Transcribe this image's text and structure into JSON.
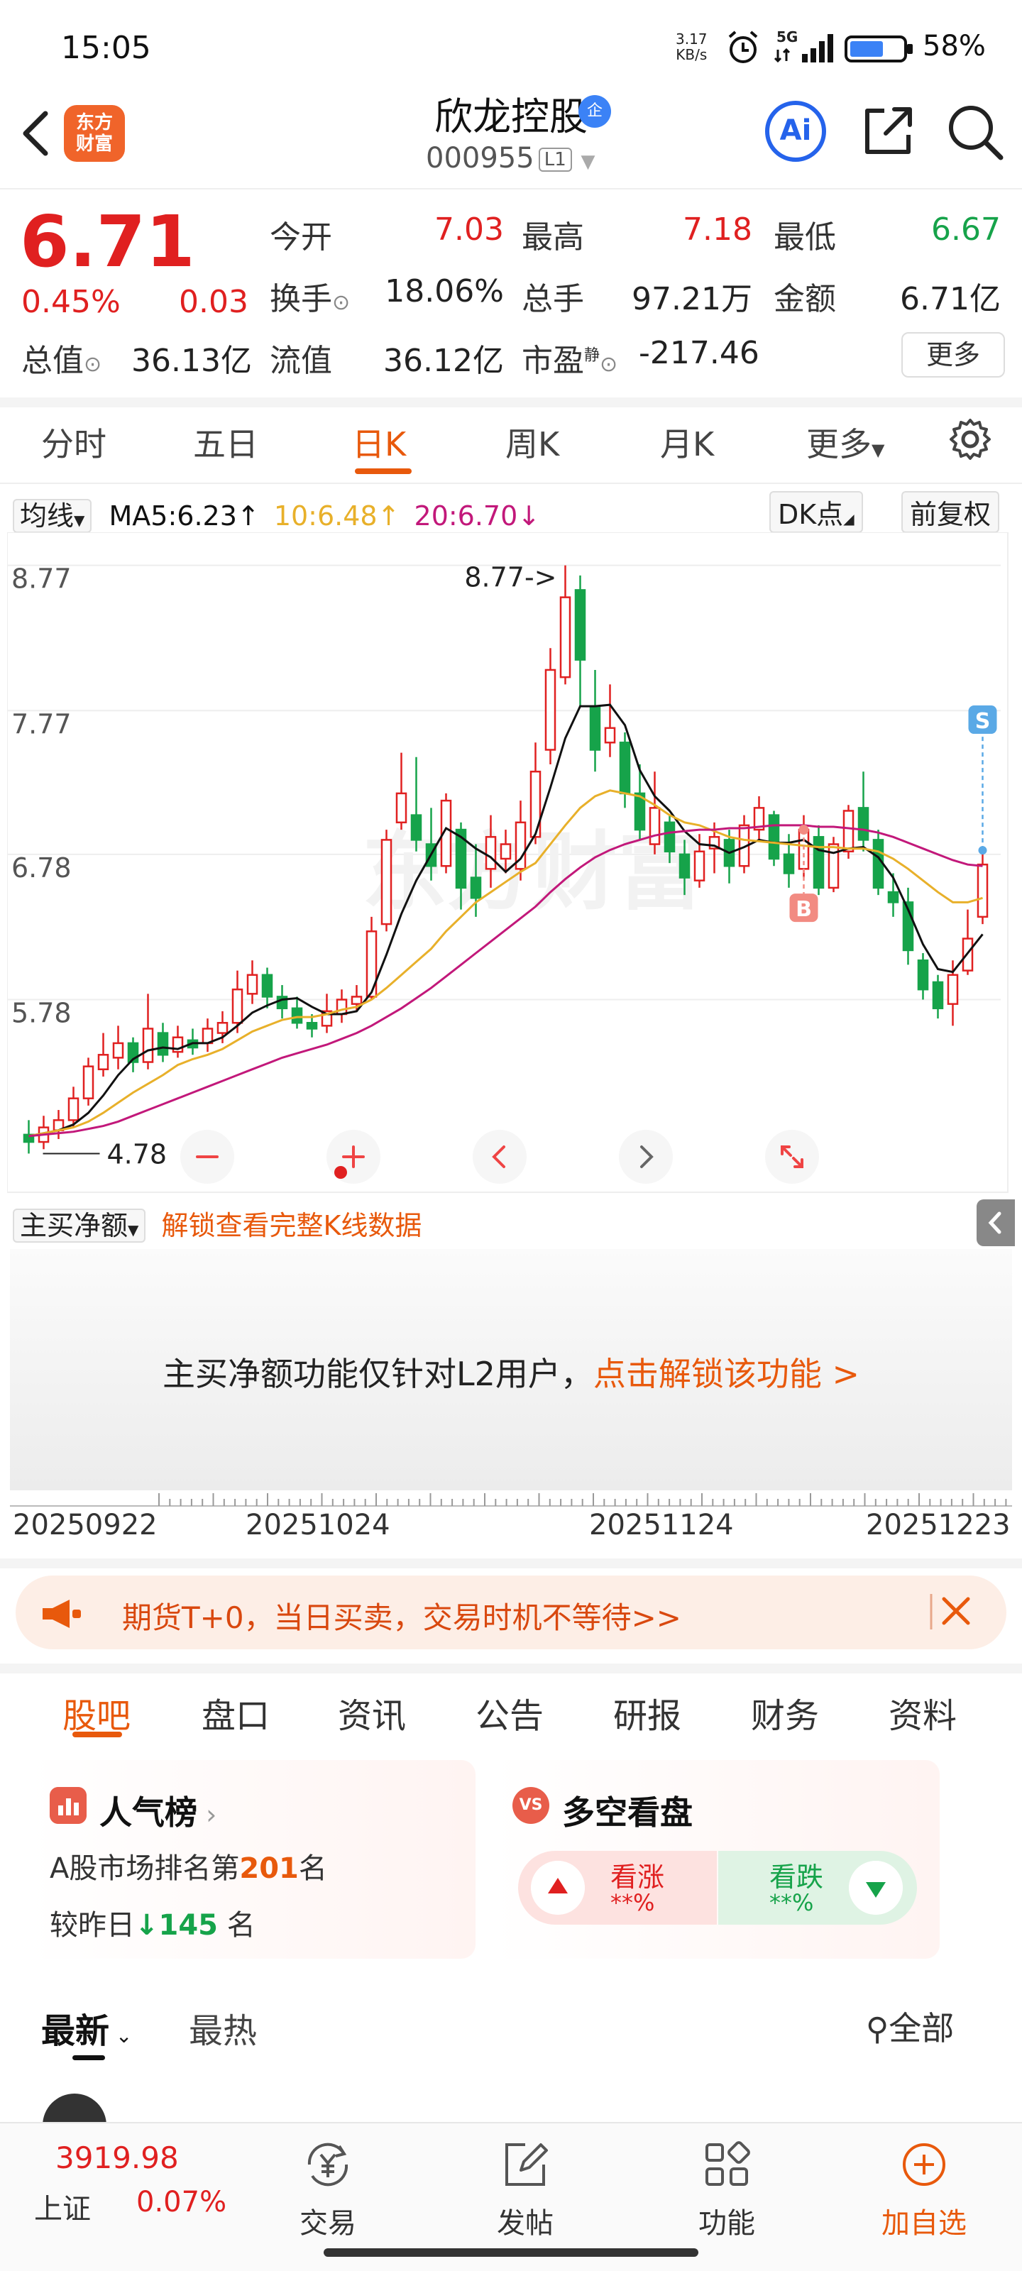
{
  "status_bar": {
    "time": "15:05",
    "net_speed_value": "3.17",
    "net_speed_unit": "KB/s",
    "signal_label": "5G",
    "battery_pct": "58%"
  },
  "header": {
    "logo_text": "东方财富",
    "stock_name": "欣龙控股",
    "badge": "企",
    "stock_code": "000955",
    "level": "L1",
    "ai_label": "Ai"
  },
  "quote": {
    "price": "6.71",
    "change_pct": "0.45%",
    "change": "0.03",
    "open_label": "今开",
    "open": "7.03",
    "high_label": "最高",
    "high": "7.18",
    "low_label": "最低",
    "low": "6.67",
    "turnover_label": "换手",
    "turnover": "18.06%",
    "volume_label": "总手",
    "volume": "97.21万",
    "amount_label": "金额",
    "amount": "6.71亿",
    "mktcap_label": "总值",
    "mktcap": "36.13亿",
    "float_label": "流值",
    "float_cap": "36.12亿",
    "pe_label": "市盈",
    "pe_sup": "静",
    "pe": "-217.46",
    "more_label": "更多"
  },
  "chart_tabs": [
    "分时",
    "五日",
    "日K",
    "周K",
    "月K",
    "更多"
  ],
  "ma_row": {
    "selector": "均线",
    "ma5": "MA5:6.23",
    "ma10": "10:6.48",
    "ma20": "20:6.70",
    "dk_label": "DK点",
    "adjust_label": "前复权"
  },
  "colors": {
    "up": "#e02020",
    "down": "#16a34a",
    "accent": "#e8590c",
    "ma5": "#111111",
    "ma10": "#e8b02a",
    "ma20": "#c2187a"
  },
  "chart_data": {
    "type": "candlestick",
    "y_ticks": [
      "8.77",
      "7.77",
      "6.78",
      "5.78"
    ],
    "ylim": [
      4.6,
      8.9
    ],
    "peak_annotation": "8.77->",
    "low_annotation": "4.78",
    "buy_marker": "B",
    "sell_marker": "S",
    "candles": [
      {
        "o": 4.85,
        "c": 4.8,
        "h": 4.95,
        "l": 4.72
      },
      {
        "o": 4.8,
        "c": 4.9,
        "h": 4.98,
        "l": 4.75
      },
      {
        "o": 4.88,
        "c": 4.95,
        "h": 5.02,
        "l": 4.82
      },
      {
        "o": 4.95,
        "c": 5.1,
        "h": 5.18,
        "l": 4.9
      },
      {
        "o": 5.1,
        "c": 5.32,
        "h": 5.38,
        "l": 5.05
      },
      {
        "o": 5.3,
        "c": 5.4,
        "h": 5.55,
        "l": 5.25
      },
      {
        "o": 5.38,
        "c": 5.48,
        "h": 5.6,
        "l": 5.3
      },
      {
        "o": 5.48,
        "c": 5.35,
        "h": 5.52,
        "l": 5.28
      },
      {
        "o": 5.35,
        "c": 5.58,
        "h": 5.82,
        "l": 5.3
      },
      {
        "o": 5.55,
        "c": 5.4,
        "h": 5.62,
        "l": 5.35
      },
      {
        "o": 5.42,
        "c": 5.52,
        "h": 5.6,
        "l": 5.38
      },
      {
        "o": 5.5,
        "c": 5.45,
        "h": 5.58,
        "l": 5.4
      },
      {
        "o": 5.48,
        "c": 5.58,
        "h": 5.65,
        "l": 5.42
      },
      {
        "o": 5.55,
        "c": 5.62,
        "h": 5.7,
        "l": 5.48
      },
      {
        "o": 5.62,
        "c": 5.85,
        "h": 5.98,
        "l": 5.55
      },
      {
        "o": 5.82,
        "c": 5.95,
        "h": 6.05,
        "l": 5.75
      },
      {
        "o": 5.95,
        "c": 5.8,
        "h": 6.0,
        "l": 5.72
      },
      {
        "o": 5.8,
        "c": 5.72,
        "h": 5.88,
        "l": 5.65
      },
      {
        "o": 5.72,
        "c": 5.62,
        "h": 5.8,
        "l": 5.58
      },
      {
        "o": 5.62,
        "c": 5.58,
        "h": 5.68,
        "l": 5.52
      },
      {
        "o": 5.6,
        "c": 5.7,
        "h": 5.82,
        "l": 5.55
      },
      {
        "o": 5.68,
        "c": 5.78,
        "h": 5.85,
        "l": 5.62
      },
      {
        "o": 5.75,
        "c": 5.8,
        "h": 5.88,
        "l": 5.7
      },
      {
        "o": 5.8,
        "c": 6.25,
        "h": 6.35,
        "l": 5.78
      },
      {
        "o": 6.3,
        "c": 6.88,
        "h": 6.95,
        "l": 6.25
      },
      {
        "o": 7.0,
        "c": 7.2,
        "h": 7.48,
        "l": 6.95
      },
      {
        "o": 7.05,
        "c": 6.88,
        "h": 7.45,
        "l": 6.8
      },
      {
        "o": 6.85,
        "c": 6.7,
        "h": 7.1,
        "l": 6.6
      },
      {
        "o": 6.7,
        "c": 7.15,
        "h": 7.2,
        "l": 6.65
      },
      {
        "o": 6.95,
        "c": 6.55,
        "h": 7.0,
        "l": 6.4
      },
      {
        "o": 6.62,
        "c": 6.48,
        "h": 6.85,
        "l": 6.35
      },
      {
        "o": 6.68,
        "c": 6.9,
        "h": 7.05,
        "l": 6.55
      },
      {
        "o": 6.75,
        "c": 6.85,
        "h": 6.95,
        "l": 6.65
      },
      {
        "o": 6.68,
        "c": 7.0,
        "h": 7.15,
        "l": 6.6
      },
      {
        "o": 6.9,
        "c": 7.35,
        "h": 7.55,
        "l": 6.85
      },
      {
        "o": 7.5,
        "c": 8.05,
        "h": 8.2,
        "l": 7.4
      },
      {
        "o": 8.0,
        "c": 8.55,
        "h": 8.77,
        "l": 7.95
      },
      {
        "o": 8.6,
        "c": 8.12,
        "h": 8.7,
        "l": 7.8
      },
      {
        "o": 7.8,
        "c": 7.5,
        "h": 8.05,
        "l": 7.35
      },
      {
        "o": 7.55,
        "c": 7.65,
        "h": 7.95,
        "l": 7.45
      },
      {
        "o": 7.55,
        "c": 7.2,
        "h": 7.62,
        "l": 7.1
      },
      {
        "o": 7.2,
        "c": 6.95,
        "h": 7.4,
        "l": 6.88
      },
      {
        "o": 6.85,
        "c": 7.1,
        "h": 7.35,
        "l": 6.78
      },
      {
        "o": 7.0,
        "c": 6.8,
        "h": 7.05,
        "l": 6.72
      },
      {
        "o": 6.78,
        "c": 6.62,
        "h": 6.88,
        "l": 6.5
      },
      {
        "o": 6.6,
        "c": 6.8,
        "h": 6.92,
        "l": 6.55
      },
      {
        "o": 6.82,
        "c": 6.9,
        "h": 7.0,
        "l": 6.65
      },
      {
        "o": 6.88,
        "c": 6.7,
        "h": 6.95,
        "l": 6.58
      },
      {
        "o": 6.7,
        "c": 6.98,
        "h": 7.05,
        "l": 6.65
      },
      {
        "o": 6.95,
        "c": 7.1,
        "h": 7.18,
        "l": 6.88
      },
      {
        "o": 7.05,
        "c": 6.75,
        "h": 7.08,
        "l": 6.7
      },
      {
        "o": 6.78,
        "c": 6.65,
        "h": 6.92,
        "l": 6.55
      },
      {
        "o": 6.68,
        "c": 6.95,
        "h": 7.05,
        "l": 6.62
      },
      {
        "o": 6.9,
        "c": 6.55,
        "h": 6.98,
        "l": 6.5
      },
      {
        "o": 6.55,
        "c": 6.85,
        "h": 6.9,
        "l": 6.52
      },
      {
        "o": 6.8,
        "c": 7.08,
        "h": 7.12,
        "l": 6.75
      },
      {
        "o": 7.1,
        "c": 6.88,
        "h": 7.35,
        "l": 6.8
      },
      {
        "o": 6.88,
        "c": 6.55,
        "h": 6.95,
        "l": 6.5
      },
      {
        "o": 6.52,
        "c": 6.45,
        "h": 6.65,
        "l": 6.35
      },
      {
        "o": 6.45,
        "c": 6.12,
        "h": 6.55,
        "l": 6.02
      },
      {
        "o": 6.05,
        "c": 5.85,
        "h": 6.1,
        "l": 5.78
      },
      {
        "o": 5.9,
        "c": 5.72,
        "h": 5.95,
        "l": 5.65
      },
      {
        "o": 5.75,
        "c": 5.95,
        "h": 6.05,
        "l": 5.6
      },
      {
        "o": 5.98,
        "c": 6.2,
        "h": 6.4,
        "l": 5.95
      },
      {
        "o": 6.35,
        "c": 6.71,
        "h": 6.82,
        "l": 6.3
      }
    ],
    "ma5": [
      4.84,
      4.86,
      4.88,
      4.92,
      5.0,
      5.12,
      5.26,
      5.37,
      5.43,
      5.45,
      5.44,
      5.48,
      5.48,
      5.52,
      5.6,
      5.69,
      5.74,
      5.78,
      5.79,
      5.73,
      5.68,
      5.68,
      5.7,
      5.83,
      6.09,
      6.37,
      6.6,
      6.78,
      6.96,
      6.9,
      6.82,
      6.76,
      6.66,
      6.75,
      6.92,
      7.24,
      7.58,
      7.8,
      7.8,
      7.81,
      7.67,
      7.36,
      7.18,
      7.08,
      6.94,
      6.85,
      6.84,
      6.79,
      6.83,
      6.88,
      6.86,
      6.86,
      6.88,
      6.81,
      6.79,
      6.82,
      6.83,
      6.76,
      6.62,
      6.4,
      6.16,
      5.99,
      5.97,
      6.1,
      6.23
    ],
    "ma10": [
      4.84,
      4.86,
      4.88,
      4.9,
      4.94,
      5.0,
      5.07,
      5.14,
      5.2,
      5.26,
      5.33,
      5.37,
      5.4,
      5.44,
      5.5,
      5.56,
      5.6,
      5.64,
      5.66,
      5.66,
      5.68,
      5.71,
      5.73,
      5.78,
      5.86,
      5.95,
      6.04,
      6.13,
      6.25,
      6.35,
      6.45,
      6.52,
      6.59,
      6.66,
      6.72,
      6.85,
      6.98,
      7.1,
      7.18,
      7.22,
      7.2,
      7.18,
      7.12,
      7.05,
      7.0,
      6.98,
      6.94,
      6.9,
      6.88,
      6.87,
      6.86,
      6.85,
      6.84,
      6.83,
      6.83,
      6.82,
      6.82,
      6.8,
      6.75,
      6.68,
      6.6,
      6.52,
      6.45,
      6.45,
      6.48
    ],
    "ma20": [
      4.84,
      4.85,
      4.86,
      4.87,
      4.89,
      4.91,
      4.94,
      4.98,
      5.02,
      5.06,
      5.1,
      5.14,
      5.18,
      5.22,
      5.26,
      5.3,
      5.34,
      5.38,
      5.41,
      5.44,
      5.47,
      5.51,
      5.55,
      5.6,
      5.66,
      5.72,
      5.79,
      5.86,
      5.94,
      6.02,
      6.1,
      6.18,
      6.26,
      6.34,
      6.42,
      6.52,
      6.61,
      6.69,
      6.76,
      6.81,
      6.85,
      6.88,
      6.91,
      6.93,
      6.94,
      6.95,
      6.95,
      6.96,
      6.96,
      6.97,
      6.98,
      6.98,
      6.98,
      6.97,
      6.97,
      6.96,
      6.95,
      6.93,
      6.9,
      6.86,
      6.82,
      6.78,
      6.74,
      6.71,
      6.7
    ]
  },
  "chart_controls": [
    "zoom-out",
    "zoom-in",
    "prev",
    "next",
    "fullscreen"
  ],
  "indicator": {
    "selector": "主买净额",
    "unlock_link": "解锁查看完整K线数据",
    "lock_msg_prefix": "主买净额功能仅针对L2用户，",
    "lock_msg_link": "点击解锁该功能 >"
  },
  "date_axis": [
    "20250922",
    "20251024",
    "20251124",
    "20251223"
  ],
  "ad": {
    "text": "期货T+0，当日买卖，交易时机不等待>>"
  },
  "info_tabs": [
    "股吧",
    "盘口",
    "资讯",
    "公告",
    "研报",
    "财务",
    "资料"
  ],
  "rank_card": {
    "title": "人气榜",
    "line1_prefix": "A股市场排名第",
    "line1_value": "201",
    "line1_suffix": "名",
    "line2_prefix": "较昨日",
    "line2_value": "145",
    "line2_suffix": " 名"
  },
  "bull_card": {
    "title": "多空看盘",
    "icon": "VS",
    "up_label": "看涨",
    "up_pct": "**%",
    "down_label": "看跌",
    "down_pct": "**%"
  },
  "feed": {
    "latest": "最新",
    "hot": "最热",
    "filter": "全部"
  },
  "bottom_nav": {
    "index_value": "3919.98",
    "index_name": "上证",
    "index_pct": "0.07%",
    "trade": "交易",
    "post": "发帖",
    "functions": "功能",
    "watchlist": "加自选"
  }
}
